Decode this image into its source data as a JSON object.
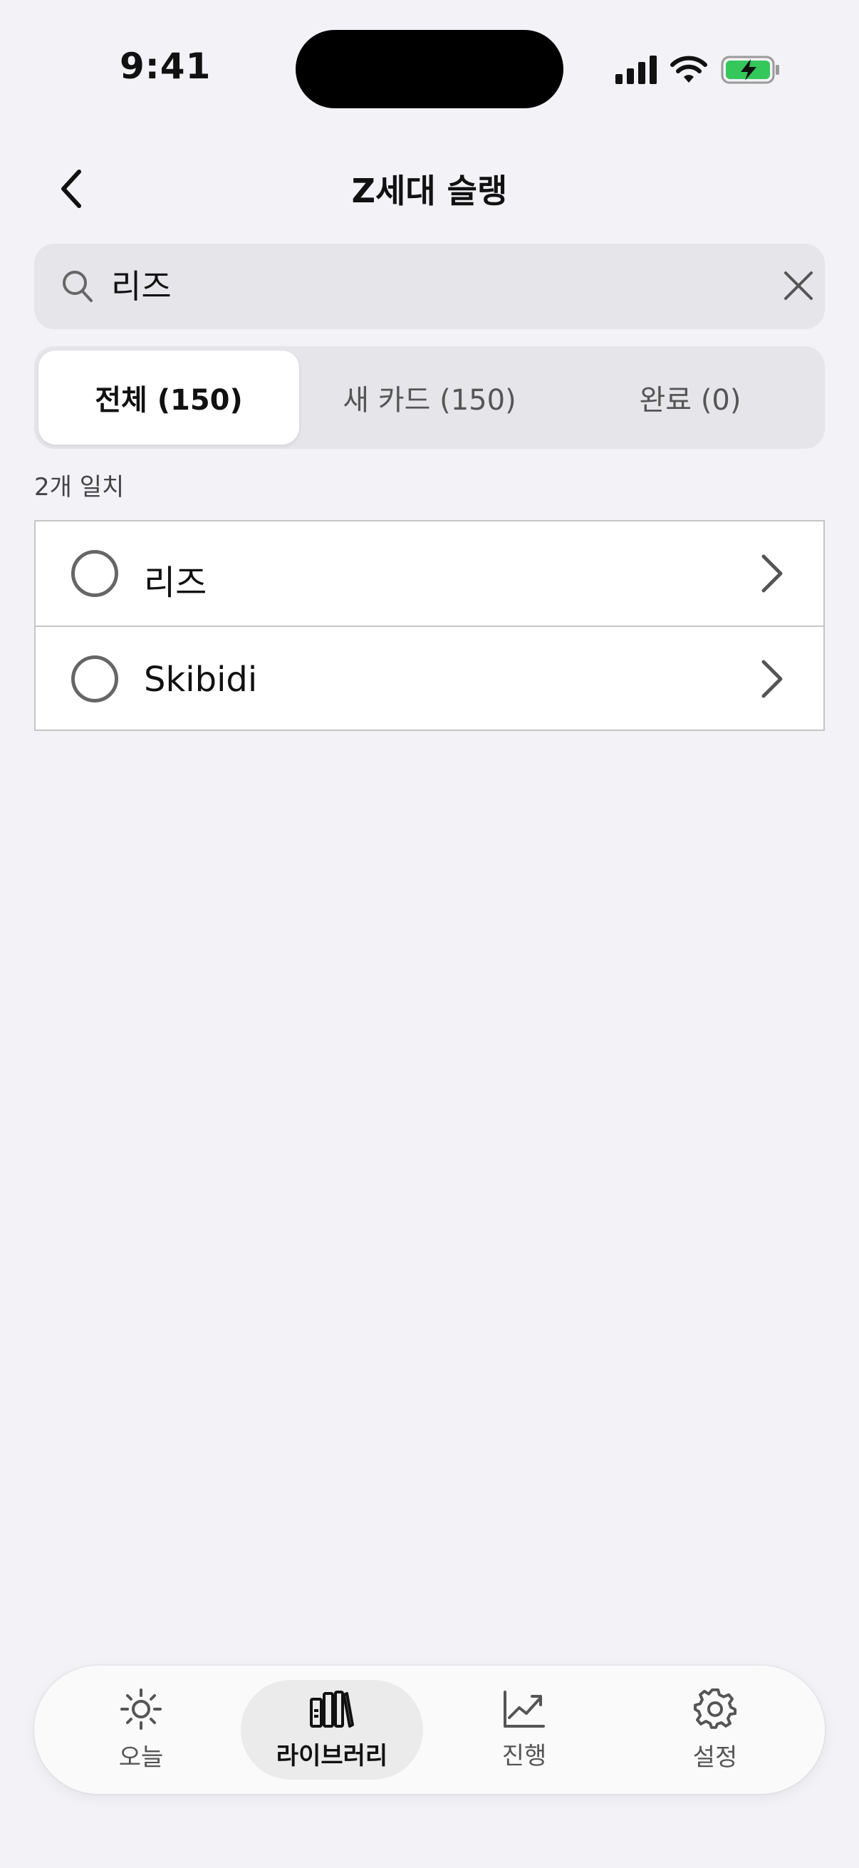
{
  "status": {
    "time": "9:41"
  },
  "nav": {
    "title": "Z세대 슬랭"
  },
  "search": {
    "value": "리즈"
  },
  "segments": [
    {
      "label": "전체 (150)",
      "active": true
    },
    {
      "label": "새 카드 (150)",
      "active": false
    },
    {
      "label": "완료 (0)",
      "active": false
    }
  ],
  "results": {
    "match_count": "2개 일치",
    "items": [
      {
        "label": "리즈"
      },
      {
        "label": "Skibidi"
      }
    ]
  },
  "tabbar": {
    "items": [
      {
        "label": "오늘",
        "icon": "sun-icon"
      },
      {
        "label": "라이브러리",
        "icon": "books-icon",
        "active": true
      },
      {
        "label": "진행",
        "icon": "chart-trend-icon"
      },
      {
        "label": "설정",
        "icon": "gear-icon"
      }
    ]
  },
  "colors": {
    "background": "#f2f2f7",
    "battery": "#34c759"
  }
}
